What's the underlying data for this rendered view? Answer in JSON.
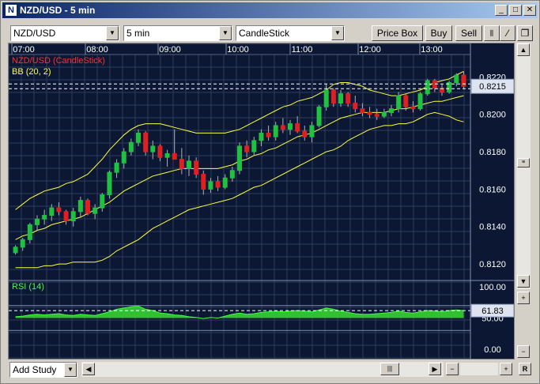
{
  "window": {
    "title": "NZD/USD - 5 min",
    "minimize": "_",
    "maximize": "□",
    "close": "✕"
  },
  "toolbar": {
    "symbol": "NZD/USD",
    "interval": "5 min",
    "chart_type": "CandleStick",
    "price_box": "Price Box",
    "buy": "Buy",
    "sell": "Sell"
  },
  "main_pane": {
    "title": "NZD/USD (CandleStick)",
    "indicator": "BB (20, 2)",
    "title_color": "#ff3030",
    "indicator_color": "#ffff40",
    "current_price": "0.8215",
    "price_ticks": [
      "0.8220",
      "0.8200",
      "0.8180",
      "0.8160",
      "0.8140",
      "0.8120"
    ],
    "time_ticks": [
      "07:00",
      "08:00",
      "09:00",
      "10:00",
      "11:00",
      "12:00",
      "13:00"
    ]
  },
  "rsi_pane": {
    "title": "RSI (14)",
    "title_color": "#40ff40",
    "ticks": [
      "100.00",
      "50.00",
      "0.00"
    ],
    "current_value": "61.83"
  },
  "bottom": {
    "add_study": "Add Study",
    "reset": "R"
  },
  "chart_data": {
    "type": "candlestick",
    "title": "NZD/USD (CandleStick)",
    "ylim": [
      0.8112,
      0.8232
    ],
    "x": [
      "07:00",
      "08:00",
      "09:00",
      "10:00",
      "11:00",
      "12:00",
      "13:00"
    ],
    "series": [
      {
        "name": "NZD/USD (CandleStick)",
        "ohlc": [
          [
            0.8126,
            0.813,
            0.8125,
            0.8129
          ],
          [
            0.8129,
            0.8134,
            0.8127,
            0.8133
          ],
          [
            0.8133,
            0.8142,
            0.8131,
            0.8141
          ],
          [
            0.8141,
            0.8146,
            0.8138,
            0.8144
          ],
          [
            0.8144,
            0.8149,
            0.8141,
            0.8146
          ],
          [
            0.8146,
            0.8152,
            0.8143,
            0.815
          ],
          [
            0.815,
            0.8153,
            0.8146,
            0.8148
          ],
          [
            0.8148,
            0.8149,
            0.8141,
            0.8143
          ],
          [
            0.8143,
            0.815,
            0.814,
            0.8148
          ],
          [
            0.8148,
            0.8156,
            0.8145,
            0.8154
          ],
          [
            0.8154,
            0.8155,
            0.8146,
            0.8147
          ],
          [
            0.8147,
            0.8152,
            0.8144,
            0.815
          ],
          [
            0.815,
            0.8158,
            0.8148,
            0.8157
          ],
          [
            0.8157,
            0.817,
            0.8155,
            0.8169
          ],
          [
            0.8169,
            0.8176,
            0.8166,
            0.8174
          ],
          [
            0.8174,
            0.8182,
            0.8171,
            0.818
          ],
          [
            0.818,
            0.8187,
            0.8178,
            0.8185
          ],
          [
            0.8185,
            0.8192,
            0.8183,
            0.819
          ],
          [
            0.819,
            0.8191,
            0.8178,
            0.818
          ],
          [
            0.818,
            0.8186,
            0.8176,
            0.8183
          ],
          [
            0.8183,
            0.8184,
            0.8175,
            0.8177
          ],
          [
            0.8177,
            0.8181,
            0.8172,
            0.8179
          ],
          [
            0.8179,
            0.8192,
            0.8176,
            0.8176
          ],
          [
            0.8176,
            0.8182,
            0.8168,
            0.8171
          ],
          [
            0.8171,
            0.8178,
            0.8167,
            0.8175
          ],
          [
            0.8175,
            0.8177,
            0.8166,
            0.8168
          ],
          [
            0.8168,
            0.817,
            0.8157,
            0.816
          ],
          [
            0.816,
            0.8166,
            0.8158,
            0.8164
          ],
          [
            0.8164,
            0.8167,
            0.8159,
            0.8161
          ],
          [
            0.8161,
            0.8168,
            0.816,
            0.8166
          ],
          [
            0.8166,
            0.8172,
            0.8164,
            0.817
          ],
          [
            0.817,
            0.8185,
            0.8168,
            0.8183
          ],
          [
            0.8183,
            0.8186,
            0.8177,
            0.818
          ],
          [
            0.818,
            0.8188,
            0.8178,
            0.8186
          ],
          [
            0.8186,
            0.8192,
            0.8183,
            0.819
          ],
          [
            0.819,
            0.8194,
            0.8186,
            0.8188
          ],
          [
            0.8188,
            0.8196,
            0.8186,
            0.8194
          ],
          [
            0.8194,
            0.8198,
            0.819,
            0.8192
          ],
          [
            0.8192,
            0.8197,
            0.8189,
            0.8195
          ],
          [
            0.8195,
            0.8199,
            0.819,
            0.8191
          ],
          [
            0.8191,
            0.8194,
            0.8186,
            0.8188
          ],
          [
            0.8188,
            0.8196,
            0.8185,
            0.8194
          ],
          [
            0.8194,
            0.8205,
            0.8193,
            0.8204
          ],
          [
            0.8204,
            0.8216,
            0.8202,
            0.8213
          ],
          [
            0.8213,
            0.8214,
            0.8204,
            0.8206
          ],
          [
            0.8206,
            0.8213,
            0.8204,
            0.8211
          ],
          [
            0.8211,
            0.8212,
            0.8204,
            0.8206
          ],
          [
            0.8206,
            0.821,
            0.8201,
            0.8203
          ],
          [
            0.8203,
            0.8206,
            0.8199,
            0.8201
          ],
          [
            0.8201,
            0.8204,
            0.8198,
            0.82
          ],
          [
            0.82,
            0.8203,
            0.8197,
            0.8199
          ],
          [
            0.8199,
            0.8203,
            0.8198,
            0.8201
          ],
          [
            0.8201,
            0.8205,
            0.8199,
            0.8203
          ],
          [
            0.8203,
            0.8212,
            0.8201,
            0.821
          ],
          [
            0.821,
            0.8211,
            0.8202,
            0.8204
          ],
          [
            0.8204,
            0.8207,
            0.8201,
            0.8203
          ],
          [
            0.8203,
            0.8212,
            0.8202,
            0.8211
          ],
          [
            0.8211,
            0.8219,
            0.821,
            0.8218
          ],
          [
            0.8218,
            0.8219,
            0.8212,
            0.8214
          ],
          [
            0.8214,
            0.8216,
            0.821,
            0.8212
          ],
          [
            0.8212,
            0.8218,
            0.8211,
            0.8217
          ],
          [
            0.8217,
            0.8222,
            0.8215,
            0.8221
          ],
          [
            0.8221,
            0.8223,
            0.8214,
            0.8215
          ]
        ]
      },
      {
        "name": "BB upper",
        "values": [
          0.8149,
          0.8152,
          0.8155,
          0.8157,
          0.8159,
          0.816,
          0.8161,
          0.8163,
          0.8164,
          0.8166,
          0.8168,
          0.8172,
          0.8176,
          0.8181,
          0.8185,
          0.8189,
          0.8192,
          0.8194,
          0.8195,
          0.8195,
          0.8195,
          0.8194,
          0.8193,
          0.8192,
          0.8191,
          0.819,
          0.819,
          0.819,
          0.819,
          0.819,
          0.8191,
          0.8192,
          0.8194,
          0.8196,
          0.8198,
          0.82,
          0.8202,
          0.8204,
          0.8205,
          0.8207,
          0.8208,
          0.8209,
          0.8211,
          0.8213,
          0.8216,
          0.8217,
          0.8217,
          0.8216,
          0.8215,
          0.8213,
          0.8212,
          0.8211,
          0.821,
          0.821,
          0.8211,
          0.8212,
          0.8213,
          0.8215,
          0.8217,
          0.8218,
          0.8219,
          0.8221,
          0.8223
        ]
      },
      {
        "name": "BB middle",
        "values": [
          0.8133,
          0.8135,
          0.8136,
          0.8138,
          0.8139,
          0.8141,
          0.8142,
          0.8143,
          0.8144,
          0.8145,
          0.8147,
          0.8149,
          0.8151,
          0.8153,
          0.8156,
          0.8159,
          0.8161,
          0.8163,
          0.8165,
          0.8167,
          0.8168,
          0.8169,
          0.817,
          0.8171,
          0.8171,
          0.8171,
          0.8171,
          0.8171,
          0.8171,
          0.8172,
          0.8173,
          0.8175,
          0.8176,
          0.8178,
          0.8179,
          0.8181,
          0.8182,
          0.8184,
          0.8186,
          0.8188,
          0.8189,
          0.819,
          0.8192,
          0.8194,
          0.8196,
          0.8198,
          0.8199,
          0.82,
          0.8201,
          0.8201,
          0.8201,
          0.8201,
          0.8202,
          0.8203,
          0.8203,
          0.8204,
          0.8205,
          0.8206,
          0.8207,
          0.8207,
          0.8208,
          0.8209,
          0.821
        ]
      },
      {
        "name": "BB lower",
        "values": [
          0.8118,
          0.8118,
          0.8118,
          0.8118,
          0.8119,
          0.8119,
          0.812,
          0.812,
          0.8121,
          0.8121,
          0.8121,
          0.8121,
          0.8122,
          0.8124,
          0.8127,
          0.8129,
          0.8131,
          0.8133,
          0.8136,
          0.8139,
          0.8141,
          0.8143,
          0.8145,
          0.8147,
          0.8149,
          0.815,
          0.8151,
          0.8152,
          0.8153,
          0.8154,
          0.8155,
          0.8157,
          0.8159,
          0.8161,
          0.8162,
          0.8164,
          0.8166,
          0.8168,
          0.817,
          0.8172,
          0.8174,
          0.8176,
          0.8178,
          0.818,
          0.8181,
          0.8183,
          0.8186,
          0.8188,
          0.819,
          0.8192,
          0.8193,
          0.8194,
          0.8194,
          0.8195,
          0.8195,
          0.8196,
          0.8198,
          0.82,
          0.8201,
          0.82,
          0.8199,
          0.8197,
          0.8196
        ]
      },
      {
        "name": "RSI (14)",
        "values": [
          52,
          53,
          55,
          56,
          55,
          56,
          57,
          55,
          54,
          56,
          55,
          54,
          57,
          60,
          64,
          66,
          68,
          69,
          64,
          62,
          58,
          57,
          55,
          54,
          52,
          51,
          49,
          51,
          50,
          53,
          56,
          58,
          56,
          57,
          59,
          60,
          61,
          60,
          61,
          62,
          61,
          60,
          63,
          66,
          64,
          61,
          59,
          57,
          56,
          56,
          57,
          58,
          59,
          61,
          59,
          58,
          60,
          62,
          61,
          60,
          62,
          63,
          62
        ]
      }
    ],
    "rsi_ylim": [
      0,
      100
    ],
    "rsi_value": 61.83,
    "current_price": 0.8215
  }
}
